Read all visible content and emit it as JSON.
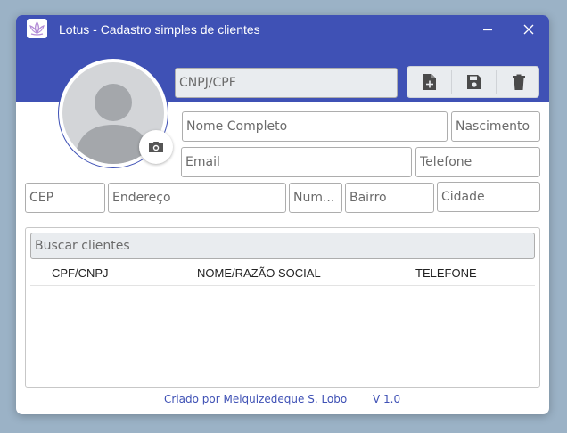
{
  "window": {
    "title": "Lotus - Cadastro simples de clientes"
  },
  "icons": {
    "app": "lotus-icon",
    "minimize": "minimize-icon",
    "close": "close-icon",
    "camera": "camera-icon",
    "new": "new-file-icon",
    "save": "save-icon",
    "delete": "trash-icon",
    "avatar": "person-placeholder-icon"
  },
  "colors": {
    "accent": "#3f51b5",
    "field_border": "#adadad",
    "field_gray": "#e9ecef"
  },
  "form": {
    "cnpj_cpf": {
      "placeholder": "CNPJ/CPF",
      "value": ""
    },
    "nome": {
      "placeholder": "Nome Completo",
      "value": ""
    },
    "nascimento": {
      "placeholder": "Nascimento",
      "value": ""
    },
    "email": {
      "placeholder": "Email",
      "value": ""
    },
    "telefone": {
      "placeholder": "Telefone",
      "value": ""
    },
    "cep": {
      "placeholder": "CEP",
      "value": ""
    },
    "endereco": {
      "placeholder": "Endereço",
      "value": ""
    },
    "numero": {
      "placeholder": "Num...",
      "value": ""
    },
    "bairro": {
      "placeholder": "Bairro",
      "value": ""
    },
    "cidade": {
      "placeholder": "Cidade",
      "value": ""
    }
  },
  "list": {
    "search_placeholder": "Buscar clientes",
    "columns": [
      "CPF/CNPJ",
      "NOME/RAZÃO SOCIAL",
      "TELEFONE"
    ],
    "rows": []
  },
  "footer": {
    "credit": "Criado por Melquizedeque S. Lobo",
    "version": "V 1.0"
  }
}
